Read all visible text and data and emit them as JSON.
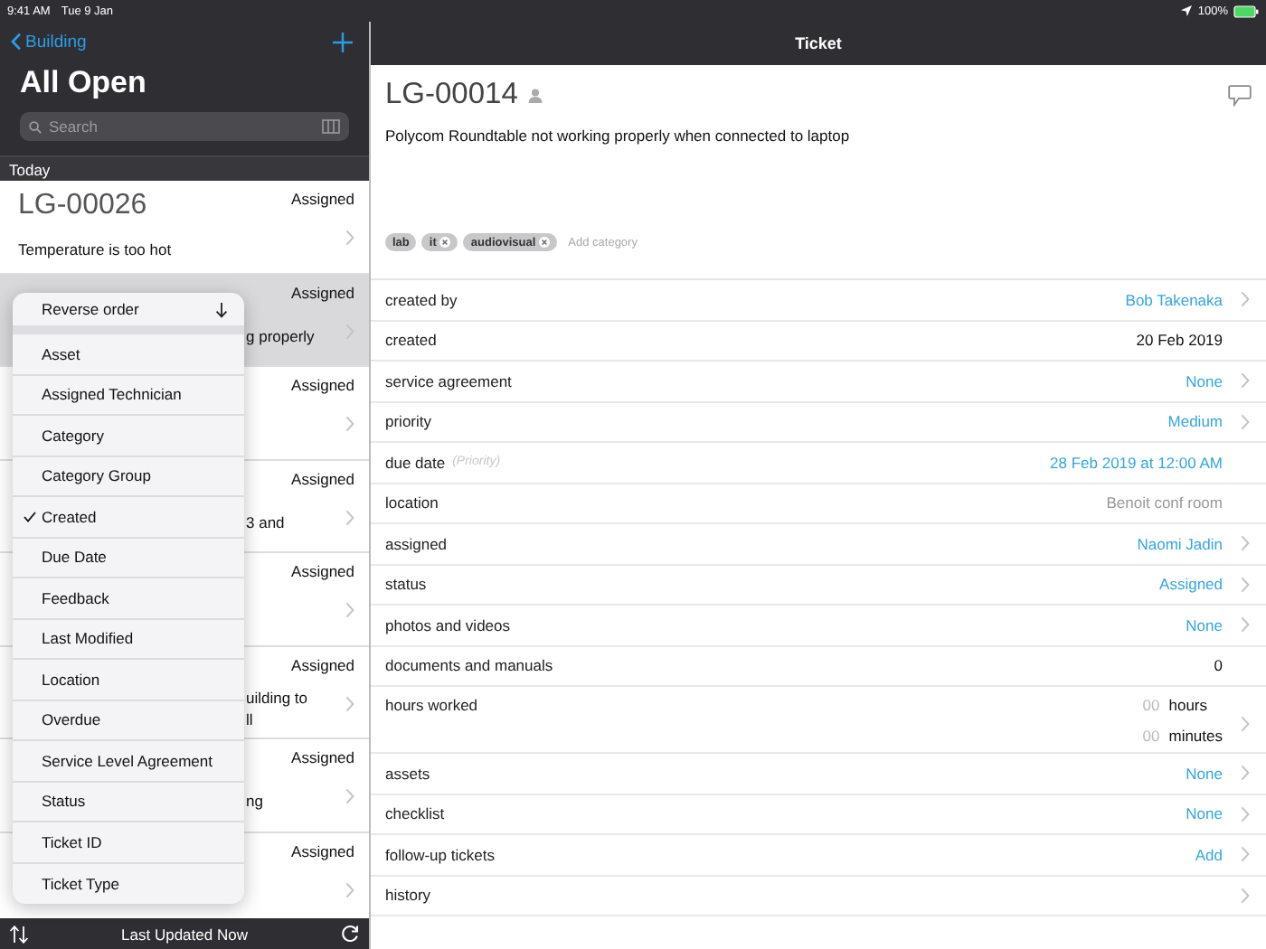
{
  "status_bar": {
    "time": "9:41 AM",
    "date": "Tue 9 Jan",
    "battery": "100%"
  },
  "sidebar": {
    "back": "Building",
    "title": "All Open",
    "search": {
      "placeholder": "Search"
    },
    "section": "Today",
    "tickets": [
      {
        "kind": "full",
        "id": "LG-00026",
        "status": "Assigned",
        "summary_lines": [
          "Temperature is too hot"
        ],
        "selected": false
      },
      {
        "kind": "clipped",
        "status": "Assigned",
        "summary_lines": [
          "g properly"
        ],
        "selected": true
      },
      {
        "kind": "clipped",
        "status": "Assigned",
        "selected": false
      },
      {
        "kind": "clipped",
        "status": "Assigned",
        "summary_lines": [
          "3 and"
        ],
        "selected": false
      },
      {
        "kind": "clipped",
        "status": "Assigned",
        "selected": false
      },
      {
        "kind": "clipped",
        "status": "Assigned",
        "summary_lines": [
          "uilding to",
          "ll"
        ],
        "selected": false
      },
      {
        "kind": "clipped",
        "status": "Assigned",
        "summary_lines": [
          "ng"
        ],
        "selected": false
      },
      {
        "kind": "clipped",
        "status": "Assigned",
        "selected": false
      }
    ],
    "toolbar": {
      "text": "Last Updated Now"
    }
  },
  "sort_menu": {
    "reverse": "Reverse order",
    "items": [
      {
        "label": "Asset",
        "checked": false
      },
      {
        "label": "Assigned Technician",
        "checked": false
      },
      {
        "label": "Category",
        "checked": false
      },
      {
        "label": "Category Group",
        "checked": false
      },
      {
        "label": "Created",
        "checked": true
      },
      {
        "label": "Due Date",
        "checked": false
      },
      {
        "label": "Feedback",
        "checked": false
      },
      {
        "label": "Last Modified",
        "checked": false
      },
      {
        "label": "Location",
        "checked": false
      },
      {
        "label": "Overdue",
        "checked": false
      },
      {
        "label": "Service Level Agreement",
        "checked": false
      },
      {
        "label": "Status",
        "checked": false
      },
      {
        "label": "Ticket ID",
        "checked": false
      },
      {
        "label": "Ticket Type",
        "checked": false
      }
    ]
  },
  "detail": {
    "nav_title": "Ticket",
    "id": "LG-00014",
    "summary": "Polycom Roundtable not working properly when connected to laptop",
    "tags": [
      {
        "label": "lab",
        "removable": false
      },
      {
        "label": "it",
        "removable": true
      },
      {
        "label": "audiovisual",
        "removable": true
      }
    ],
    "add_tag_placeholder": "Add category",
    "fields": [
      {
        "kind": "link",
        "label": "created by",
        "value": "Bob Takenaka",
        "chevron": true
      },
      {
        "kind": "plain",
        "label": "created",
        "value": "20 Feb 2019",
        "chevron": false
      },
      {
        "kind": "link",
        "label": "service agreement",
        "value": "None",
        "chevron": true
      },
      {
        "kind": "link",
        "label": "priority",
        "value": "Medium",
        "chevron": true
      },
      {
        "kind": "link",
        "label": "due date",
        "note": "(Priority)",
        "value": "28 Feb 2019 at 12:00 AM",
        "chevron": false
      },
      {
        "kind": "muted",
        "label": "location",
        "value": "Benoit conf room",
        "chevron": false
      },
      {
        "kind": "link",
        "label": "assigned",
        "value": "Naomi Jadin",
        "chevron": true
      },
      {
        "kind": "link",
        "label": "status",
        "value": "Assigned",
        "chevron": true
      },
      {
        "kind": "link",
        "label": "photos and videos",
        "value": "None",
        "chevron": true
      },
      {
        "kind": "plain",
        "label": "documents and manuals",
        "value": "0",
        "chevron": false
      },
      {
        "kind": "duration",
        "label": "hours worked",
        "parts": [
          {
            "placeholder": "00",
            "unit": "hours"
          },
          {
            "placeholder": "00",
            "unit": "minutes"
          }
        ],
        "chevron": true
      },
      {
        "kind": "link",
        "label": "assets",
        "value": "None",
        "chevron": true
      },
      {
        "kind": "link",
        "label": "checklist",
        "value": "None",
        "chevron": true
      },
      {
        "kind": "link",
        "label": "follow-up tickets",
        "value": "Add",
        "chevron": true
      },
      {
        "kind": "plain",
        "label": "history",
        "chevron": true
      }
    ]
  }
}
